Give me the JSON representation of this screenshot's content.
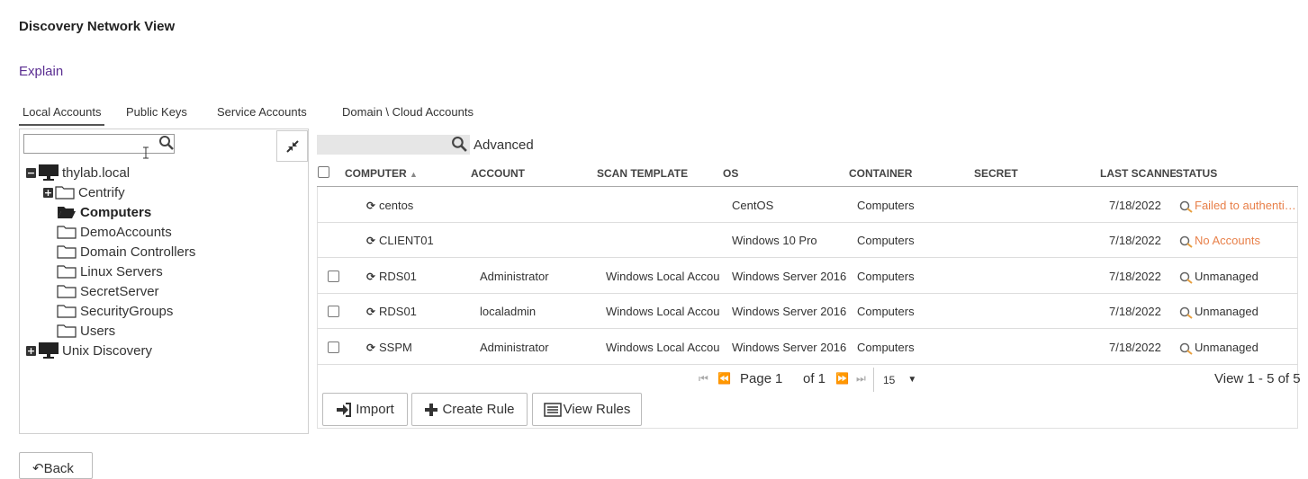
{
  "page": {
    "title": "Discovery Network View",
    "explain_link": "Explain"
  },
  "tabs": [
    {
      "label": "Local Accounts",
      "active": true
    },
    {
      "label": "Public Keys",
      "active": false
    },
    {
      "label": "Service Accounts",
      "active": false
    },
    {
      "label": "Domain \\ Cloud Accounts",
      "active": false
    }
  ],
  "tree": {
    "search_value": "",
    "nodes": [
      {
        "label": "thylab.local",
        "toggle": "−",
        "icon": "monitor-icon"
      },
      {
        "label": "Centrify",
        "toggle": "+",
        "icon": "folder-icon"
      },
      {
        "label": "Computers",
        "icon": "folder-open-icon",
        "selected": true
      },
      {
        "label": "DemoAccounts",
        "icon": "folder-icon"
      },
      {
        "label": "Domain Controllers",
        "icon": "folder-icon"
      },
      {
        "label": "Linux Servers",
        "icon": "folder-icon"
      },
      {
        "label": "SecretServer",
        "icon": "folder-icon"
      },
      {
        "label": "SecurityGroups",
        "icon": "folder-icon"
      },
      {
        "label": "Users",
        "icon": "folder-icon"
      },
      {
        "label": "Unix Discovery",
        "toggle": "+",
        "icon": "monitor-icon"
      }
    ]
  },
  "grid": {
    "search_value": "",
    "advanced_label": "Advanced",
    "columns": [
      "COMPUTER",
      "ACCOUNT",
      "SCAN TEMPLATE",
      "OS",
      "CONTAINER",
      "SECRET",
      "LAST SCANNED",
      "STATUS"
    ],
    "rows": [
      {
        "computer": "centos",
        "account": "",
        "scan_template": "",
        "os": "CentOS",
        "container": "Computers",
        "secret": "",
        "last_scanned": "7/18/2022",
        "status": "Failed to authenti…",
        "status_type": "error",
        "checkbox": false
      },
      {
        "computer": "CLIENT01",
        "account": "",
        "scan_template": "",
        "os": "Windows 10 Pro",
        "container": "Computers",
        "secret": "",
        "last_scanned": "7/18/2022",
        "status": "No Accounts",
        "status_type": "error",
        "checkbox": false
      },
      {
        "computer": "RDS01",
        "account": "Administrator",
        "scan_template": "Windows Local Accou",
        "os": "Windows Server 2016",
        "container": "Computers",
        "secret": "",
        "last_scanned": "7/18/2022",
        "status": "Unmanaged",
        "status_type": "ok",
        "checkbox": true
      },
      {
        "computer": "RDS01",
        "account": "localadmin",
        "scan_template": "Windows Local Accou",
        "os": "Windows Server 2016",
        "container": "Computers",
        "secret": "",
        "last_scanned": "7/18/2022",
        "status": "Unmanaged",
        "status_type": "ok",
        "checkbox": true
      },
      {
        "computer": "SSPM",
        "account": "Administrator",
        "scan_template": "Windows Local Accou",
        "os": "Windows Server 2016",
        "container": "Computers",
        "secret": "",
        "last_scanned": "7/18/2022",
        "status": "Unmanaged",
        "status_type": "ok",
        "checkbox": true
      }
    ]
  },
  "pager": {
    "page_label": "Page",
    "page_value": "1",
    "of_label": "of 1",
    "page_size": "15",
    "view_text": "View 1 - 5 of 5"
  },
  "actions": {
    "import": "Import",
    "create_rule": "Create Rule",
    "view_rules": "View Rules",
    "back": "Back"
  },
  "colors": {
    "error": "#e8804a",
    "link": "#5a2d91"
  }
}
